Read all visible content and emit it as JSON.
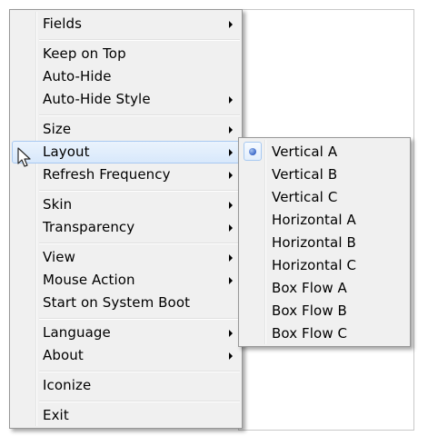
{
  "main_menu": {
    "items": [
      {
        "label": "Fields",
        "submenu": true
      },
      {
        "label": "Keep on Top",
        "submenu": false
      },
      {
        "label": "Auto-Hide",
        "submenu": false
      },
      {
        "label": "Auto-Hide Style",
        "submenu": true
      },
      {
        "label": "Size",
        "submenu": true
      },
      {
        "label": "Layout",
        "submenu": true,
        "highlighted": true
      },
      {
        "label": "Refresh Frequency",
        "submenu": true
      },
      {
        "label": "Skin",
        "submenu": true
      },
      {
        "label": "Transparency",
        "submenu": true
      },
      {
        "label": "View",
        "submenu": true
      },
      {
        "label": "Mouse Action",
        "submenu": true
      },
      {
        "label": "Start on System Boot",
        "submenu": false
      },
      {
        "label": "Language",
        "submenu": true
      },
      {
        "label": "About",
        "submenu": true
      },
      {
        "label": "Iconize",
        "submenu": false
      },
      {
        "label": "Exit",
        "submenu": false
      }
    ]
  },
  "layout_submenu": {
    "selected": "Vertical A",
    "items": [
      {
        "label": "Vertical A"
      },
      {
        "label": "Vertical B"
      },
      {
        "label": "Vertical C"
      },
      {
        "label": "Horizontal A"
      },
      {
        "label": "Horizontal B"
      },
      {
        "label": "Horizontal C"
      },
      {
        "label": "Box Flow A"
      },
      {
        "label": "Box Flow B"
      },
      {
        "label": "Box Flow C"
      }
    ]
  },
  "colors": {
    "menu_bg": "#f0f0f0",
    "highlight_border": "#a8c9f1",
    "radio_accent": "#3a66c7"
  },
  "icons": {
    "submenu": "chevron-right-icon",
    "radio": "radio-bullet-icon",
    "cursor": "mouse-pointer-icon"
  }
}
